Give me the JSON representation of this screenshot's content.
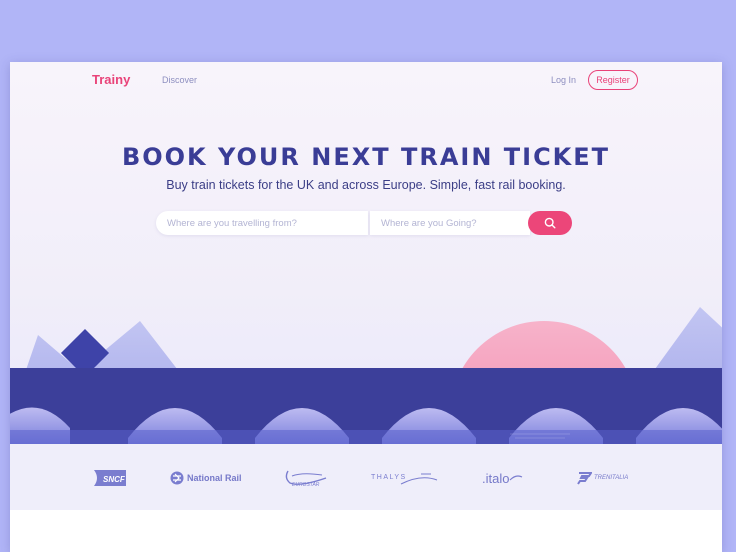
{
  "nav": {
    "brand": "Trainy",
    "discover": "Discover",
    "login": "Log In",
    "register": "Register"
  },
  "hero": {
    "headline": "BOOK YOUR NEXT TRAIN TICKET",
    "subline": "Buy train tickets for the UK and across Europe. Simple, fast rail booking."
  },
  "search": {
    "from_placeholder": "Where are you travelling from?",
    "to_placeholder": "Where are you Going?",
    "button_icon": "search-icon"
  },
  "partners": [
    {
      "name": "SNCF",
      "icon": "sncf-logo"
    },
    {
      "name": "National Rail",
      "icon": "national-rail-logo"
    },
    {
      "name": "EUROSTAR",
      "icon": "eurostar-logo"
    },
    {
      "name": "THALYS",
      "icon": "thalys-logo"
    },
    {
      "name": ".italo",
      "icon": "italo-logo"
    },
    {
      "name": "TRENITALIA",
      "icon": "trenitalia-logo"
    }
  ],
  "colors": {
    "background": "#b1b5f7",
    "brand": "#e94379",
    "headline": "#3a3d96",
    "bridge": "#3c3f9a",
    "sun": "#f6a2bf"
  }
}
